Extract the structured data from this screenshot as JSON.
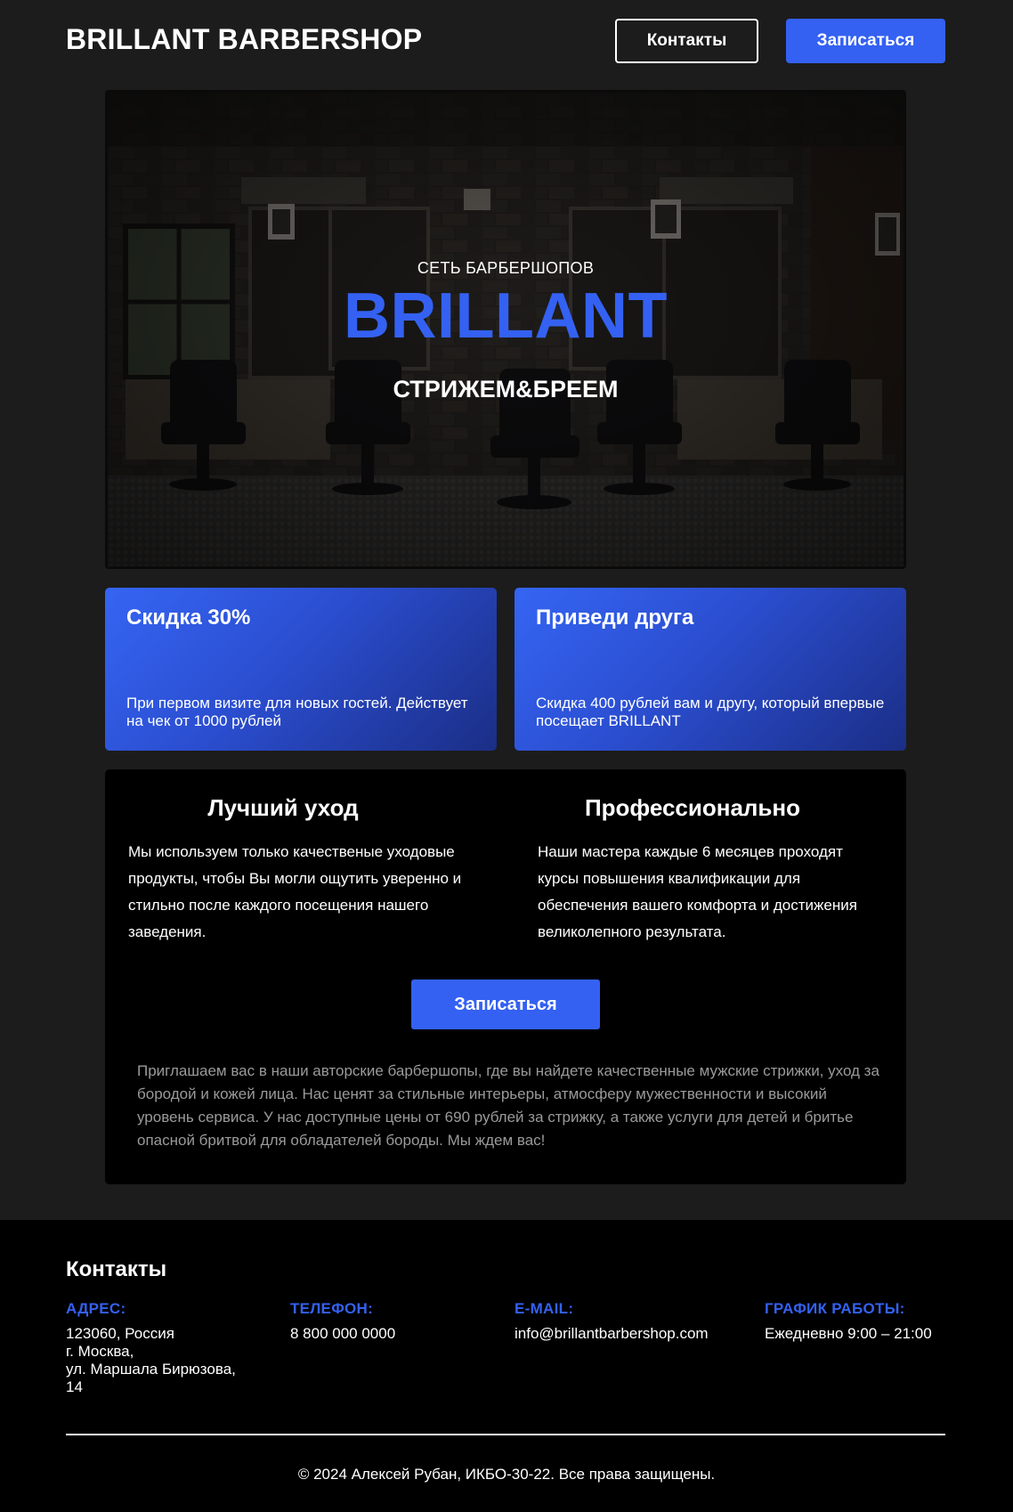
{
  "header": {
    "logo": "BRILLANT BARBERSHOP",
    "contacts_button": "Контакты",
    "signup_button": "Записаться"
  },
  "hero": {
    "subtitle": "СЕТЬ БАРБЕРШОПОВ",
    "title": "BRILLANT",
    "tagline": "СТРИЖЕМ&БРЕЕМ"
  },
  "promos": [
    {
      "title": "Скидка 30%",
      "text": "При первом визите для новых гостей. Действует на чек от 1000 рублей"
    },
    {
      "title": "Приведи друга",
      "text": "Скидка 400 рублей вам и другу, который впервые посещает BRILLANT"
    }
  ],
  "info": {
    "columns": [
      {
        "title": "Лучший уход",
        "text": "Мы используем только качественые уходовые продукты, чтобы Вы могли ощутить уверенно и стильно после каждого посещения нашего заведения."
      },
      {
        "title": "Профессионально",
        "text": "Наши мастера каждые 6 месяцев проходят курсы повышения квалификации для обеспечения вашего комфорта и достижения великолепного результата."
      }
    ],
    "button": "Записаться",
    "description": "Приглашаем вас в наши авторские барбершопы, где вы найдете качественные мужские стрижки, уход за бородой и кожей лица. Нас ценят за стильные интерьеры, атмосферу мужественности и высокий уровень сервиса. У нас доступные цены от 690 рублей за стрижку, а также услуги для детей и бритье опасной бритвой для обладателей бороды. Мы ждем вас!"
  },
  "footer": {
    "title": "Контакты",
    "address_label": "АДРЕС:",
    "address_value": "123060, Россия\nг. Москва,\nул. Маршала Бирюзова,\n14",
    "phone_label": "ТЕЛЕФОН:",
    "phone_value": "8 800 000 0000",
    "email_label": "E-MAIL:",
    "email_value": "info@brillantbarbershop.com",
    "hours_label": "ГРАФИК РАБОТЫ:",
    "hours_value": "Ежедневно 9:00 – 21:00",
    "copyright": "© 2024 Алексей Рубан, ИКБО-30-22. Все права защищены."
  },
  "colors": {
    "accent": "#3461f2",
    "page_bg": "#1c1c1c",
    "panel_bg": "#000000",
    "muted_text": "#9a9a9a"
  }
}
